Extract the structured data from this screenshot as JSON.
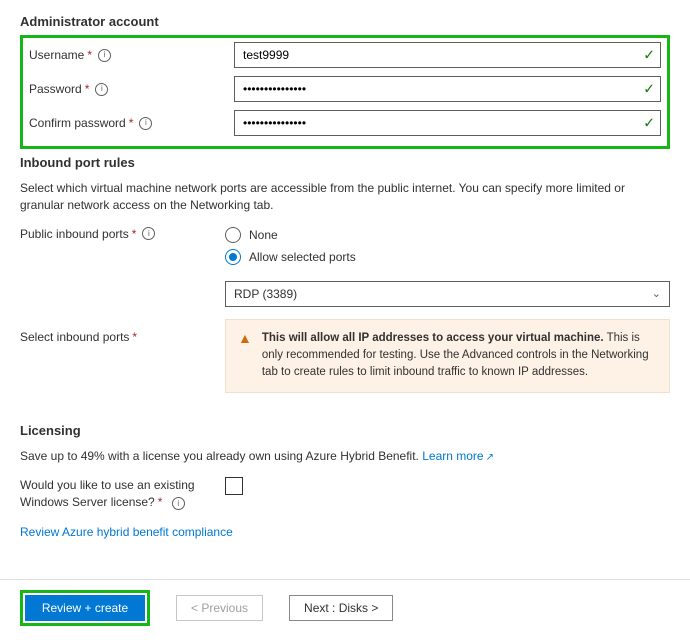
{
  "admin": {
    "title": "Administrator account",
    "username_label": "Username",
    "username_value": "test9999",
    "password_label": "Password",
    "password_value": "•••••••••••••••",
    "confirm_label": "Confirm password",
    "confirm_value": "•••••••••••••••"
  },
  "ports": {
    "title": "Inbound port rules",
    "desc": "Select which virtual machine network ports are accessible from the public internet. You can specify more limited or granular network access on the Networking tab.",
    "public_label": "Public inbound ports",
    "opt_none": "None",
    "opt_allow": "Allow selected ports",
    "select_label": "Select inbound ports",
    "select_value": "RDP (3389)",
    "warn_bold": "This will allow all IP addresses to access your virtual machine.",
    "warn_rest": " This is only recommended for testing. Use the Advanced controls in the Networking tab to create rules to limit inbound traffic to known IP addresses."
  },
  "licensing": {
    "title": "Licensing",
    "desc_pre": "Save up to 49% with a license you already own using Azure Hybrid Benefit. ",
    "learn_more": "Learn more",
    "existing_label_l1": "Would you like to use an existing",
    "existing_label_l2": "Windows Server license?",
    "compliance_link": "Review Azure hybrid benefit compliance"
  },
  "footer": {
    "review": "Review + create",
    "previous": "< Previous",
    "next": "Next : Disks >"
  }
}
